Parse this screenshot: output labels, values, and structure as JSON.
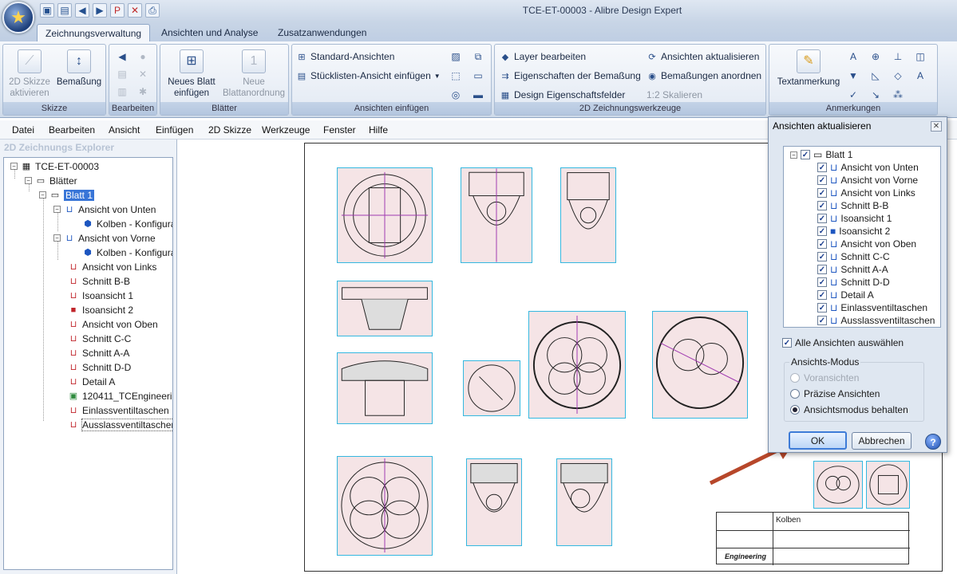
{
  "window": {
    "title": "TCE-ET-00003 - Alibre Design Expert"
  },
  "qat_icons": [
    "save-icon",
    "new-icon",
    "back-icon",
    "forward-icon",
    "pdf-icon",
    "close-doc-icon",
    "print-icon"
  ],
  "tabs": [
    {
      "label": "Zeichnungsverwaltung",
      "active": true
    },
    {
      "label": "Ansichten und Analyse",
      "active": false
    },
    {
      "label": "Zusatzanwendungen",
      "active": false
    }
  ],
  "ribbon": {
    "skizze": {
      "label": "Skizze",
      "btn1": "2D Skizze",
      "btn1b": "aktivieren",
      "btn2": "Bemaßung"
    },
    "bearbeiten": {
      "label": "Bearbeiten"
    },
    "blaetter": {
      "label": "Blätter",
      "btn1": "Neues Blatt",
      "btn1b": "einfügen",
      "btn2": "Neue",
      "btn2b": "Blattanordnung"
    },
    "ansichten": {
      "label": "Ansichten einfügen",
      "btn1": "Standard-Ansichten",
      "btn2": "Stücklisten-Ansicht einfügen"
    },
    "werkzeuge": {
      "label": "2D Zeichnungswerkzeuge",
      "btn1": "Layer bearbeiten",
      "btn2": "Eigenschaften der Bemaßung",
      "btn3": "Design Eigenschaftsfelder",
      "btn4": "Ansichten aktualisieren",
      "btn5": "Bemaßungen anordnen",
      "btn6": "1:2 Skalieren"
    },
    "anmerkungen": {
      "label": "Anmerkungen",
      "btn1": "Textanmerkung"
    }
  },
  "menu": [
    "Datei",
    "Bearbeiten",
    "Ansicht",
    "Einfügen",
    "2D Skizze",
    "Werkzeuge",
    "Fenster",
    "Hilfe"
  ],
  "explorer": {
    "title": "2D Zeichnungs Explorer",
    "root": "TCE-ET-00003",
    "blaetter": "Blätter",
    "blatt": "Blatt 1",
    "items": [
      {
        "label": "Ansicht von Unten",
        "color": "blue"
      },
      {
        "label": "Kolben - Konfigura",
        "color": "part"
      },
      {
        "label": "Ansicht von Vorne",
        "color": "blue"
      },
      {
        "label": "Kolben - Konfigura",
        "color": "part"
      },
      {
        "label": "Ansicht von Links",
        "color": "red"
      },
      {
        "label": "Schnitt B-B",
        "color": "red"
      },
      {
        "label": "Isoansicht 1",
        "color": "red"
      },
      {
        "label": "Isoansicht 2",
        "color": "red"
      },
      {
        "label": "Ansicht von Oben",
        "color": "red"
      },
      {
        "label": "Schnitt C-C",
        "color": "red"
      },
      {
        "label": "Schnitt A-A",
        "color": "red"
      },
      {
        "label": "Schnitt D-D",
        "color": "red"
      },
      {
        "label": "Detail A",
        "color": "red"
      },
      {
        "label": "120411_TCEngineerin",
        "color": "image"
      },
      {
        "label": "Einlassventiltaschen",
        "color": "red"
      },
      {
        "label": "Ausslassventiltaschen",
        "color": "red"
      }
    ]
  },
  "dialog": {
    "title": "Ansichten aktualisieren",
    "root": "Blatt 1",
    "views": [
      "Ansicht von Unten",
      "Ansicht von Vorne",
      "Ansicht von Links",
      "Schnitt B-B",
      "Isoansicht 1",
      "Isoansicht 2",
      "Ansicht von Oben",
      "Schnitt C-C",
      "Schnitt A-A",
      "Schnitt D-D",
      "Detail A",
      "Einlassventiltaschen",
      "Ausslassventiltaschen"
    ],
    "select_all": "Alle Ansichten auswählen",
    "mode_label": "Ansichts-Modus",
    "modes": [
      {
        "label": "Voransichten",
        "checked": false,
        "disabled": true
      },
      {
        "label": "Präzise Ansichten",
        "checked": false,
        "disabled": false
      },
      {
        "label": "Ansichtsmodus behalten",
        "checked": true,
        "disabled": false
      }
    ],
    "ok": "OK",
    "cancel": "Abbrechen"
  },
  "title_block": {
    "part": "Kolben",
    "company": "Engineering"
  },
  "colors": {
    "accent": "#3875d7",
    "view_border": "#34b8e0",
    "arrow": "#b7472a"
  }
}
